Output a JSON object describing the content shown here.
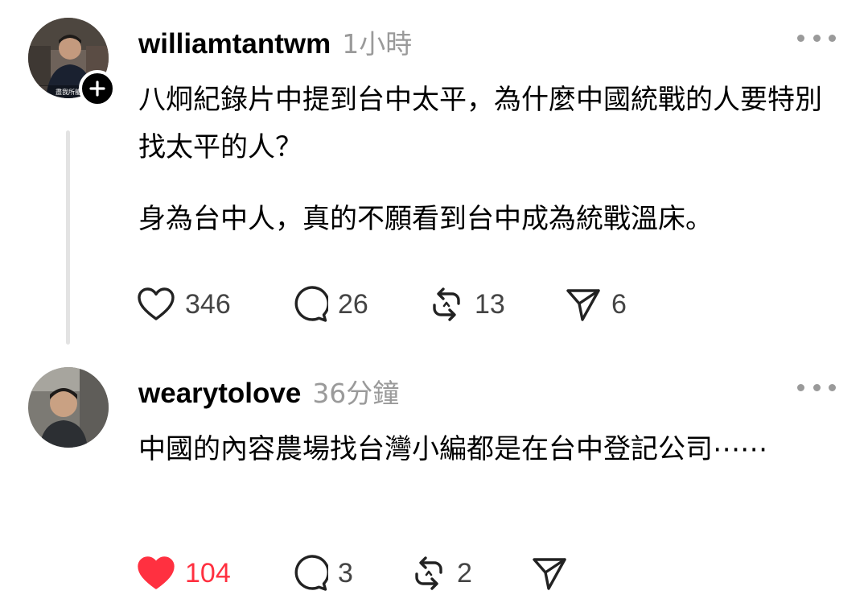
{
  "posts": [
    {
      "username": "williamtantwm",
      "time": "1小時",
      "avatar_caption": "盡我所能",
      "paragraphs": [
        "八炯紀錄片中提到台中太平，為什麼中國統戰的人要特別找太平的人？",
        "身為台中人，真的不願看到台中成為統戰溫床。"
      ],
      "likes": "346",
      "comments": "26",
      "reposts": "13",
      "shares": "6",
      "liked": false
    },
    {
      "username": "wearytolove",
      "time": "36分鐘",
      "paragraphs": [
        "中國的內容農場找台灣小編都是在台中登記公司⋯⋯"
      ],
      "likes": "104",
      "comments": "3",
      "reposts": "2",
      "shares": "",
      "liked": true
    }
  ],
  "icons": {
    "like": "heart-icon",
    "comment": "speech-bubble-icon",
    "repost": "repost-icon",
    "share": "send-icon",
    "more": "more-dots-icon",
    "follow": "plus-icon"
  },
  "colors": {
    "like_active": "#ff3040",
    "muted": "#9a9a9a",
    "text": "#000000",
    "thread_line": "#e3e3e3"
  }
}
